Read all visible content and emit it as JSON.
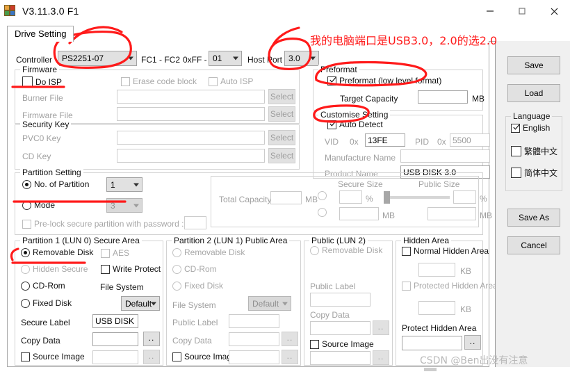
{
  "window": {
    "title": "V3.11.3.0 F1",
    "app_icon": "blocks-icon",
    "minimize": "minimize-icon",
    "maximize": "maximize-icon",
    "close": "close-icon"
  },
  "tabs": [
    {
      "label": "Drive Setting",
      "selected": true
    }
  ],
  "controller_row": {
    "label": "Controller",
    "value": "PS2251-07",
    "fc_label": "FC1 - FC2",
    "fc_prefix": "0xFF -",
    "fc_value": "01",
    "host_port_label": "Host Port",
    "host_port_value": "3.0"
  },
  "firmware": {
    "legend": "Firmware",
    "do_isp": {
      "label": "Do ISP",
      "checked": false
    },
    "erase_code_block": {
      "label": "Erase code block",
      "checked": false,
      "disabled": true
    },
    "auto_isp": {
      "label": "Auto ISP",
      "checked": false,
      "disabled": true
    },
    "burner_file": {
      "label": "Burner File",
      "value": "",
      "button": "Select"
    },
    "firmware_file": {
      "label": "Firmware File",
      "value": "",
      "button": "Select"
    }
  },
  "security_key": {
    "legend": "Security Key",
    "pvc0_key": {
      "label": "PVC0 Key",
      "value": "",
      "button": "Select"
    },
    "cd_key": {
      "label": "CD Key",
      "value": "",
      "button": "Select"
    }
  },
  "preformat": {
    "legend": "Preformat",
    "preformat": {
      "label": "Preformat (low level format)",
      "checked": true
    },
    "target_capacity": {
      "label": "Target Capacity",
      "value": "",
      "unit": "MB"
    }
  },
  "customise_setting": {
    "legend": "Customise Setting",
    "auto_detect": {
      "label": "Auto Detect",
      "checked": true
    },
    "vid": {
      "label": "VID",
      "prefix": "0x",
      "value": "13FE"
    },
    "pid": {
      "label": "PID",
      "prefix": "0x",
      "value": "5500"
    },
    "manufacture_name": {
      "label": "Manufacture Name",
      "value": ""
    },
    "product_name": {
      "label": "Product Name",
      "value": "USB DISK 3.0"
    }
  },
  "partition_setting": {
    "legend": "Partition Setting",
    "no_of_partition": {
      "label": "No. of Partition",
      "selected": true,
      "value": "1"
    },
    "mode": {
      "label": "Mode",
      "selected": false,
      "value": "3",
      "disabled": true
    },
    "prelock": {
      "label": "Pre-lock secure partition with password :",
      "checked": false,
      "disabled": true,
      "value": ""
    },
    "total_capacity": {
      "label": "Total Capacity",
      "value": "",
      "unit": "MB"
    },
    "secure_size_label": "Secure Size",
    "public_size_label": "Public Size",
    "secure_percent": "",
    "public_percent": "",
    "secure_mb": "",
    "public_mb": "",
    "percent_unit": "%",
    "mb_unit": "MB"
  },
  "partition1": {
    "legend": "Partition 1 (LUN 0) Secure Area",
    "removable_disk": {
      "label": "Removable Disk",
      "selected": true
    },
    "hidden_secure": {
      "label": "Hidden Secure",
      "selected": false,
      "disabled": true
    },
    "cd_rom": {
      "label": "CD-Rom",
      "selected": false
    },
    "fixed_disk": {
      "label": "Fixed Disk",
      "selected": false
    },
    "aes": {
      "label": "AES",
      "checked": false,
      "disabled": true
    },
    "write_protect": {
      "label": "Write Protect",
      "checked": false
    },
    "file_system": {
      "label": "File System",
      "value": "Default"
    },
    "secure_label": {
      "label": "Secure Label",
      "value": "USB DISK"
    },
    "copy_data": {
      "label": "Copy Data",
      "value": "",
      "button": ".."
    },
    "source_image": {
      "label": "Source Image",
      "checked": false,
      "value": "",
      "button": "..",
      "disabled": true
    }
  },
  "partition2": {
    "legend": "Partition 2 (LUN 1) Public Area",
    "removable_disk": {
      "label": "Removable Disk",
      "selected": false,
      "disabled": true
    },
    "cd_rom": {
      "label": "CD-Rom",
      "selected": false,
      "disabled": true
    },
    "fixed_disk": {
      "label": "Fixed Disk",
      "selected": false,
      "disabled": true
    },
    "file_system": {
      "label": "File System",
      "value": "Default",
      "disabled": true
    },
    "public_label": {
      "label": "Public Label",
      "value": "",
      "disabled": true
    },
    "copy_data": {
      "label": "Copy Data",
      "value": "",
      "button": "..",
      "disabled": true
    },
    "source_image": {
      "label": "Source Image",
      "checked": false,
      "value": "",
      "button": "..",
      "disabled": true
    }
  },
  "public_lun2": {
    "legend": "Public (LUN 2)",
    "removable_disk": {
      "label": "Removable Disk",
      "selected": false,
      "disabled": true
    },
    "public_label": {
      "label": "Public Label",
      "value": "",
      "disabled": true
    },
    "copy_data": {
      "label": "Copy Data",
      "value": "",
      "button": "..",
      "disabled": true
    },
    "source_image": {
      "label": "Source Image",
      "checked": false,
      "value": "",
      "button": "..",
      "disabled": true
    }
  },
  "hidden_area": {
    "legend": "Hidden Area",
    "normal_hidden_area": {
      "label": "Normal Hidden Area",
      "checked": false
    },
    "normal_size": {
      "value": "",
      "unit": "KB"
    },
    "protected_hidden_area": {
      "label": "Protected Hidden Area",
      "checked": false,
      "disabled": true
    },
    "protected_size": {
      "value": "",
      "unit": "KB"
    },
    "protect_hidden_area": {
      "label": "Protect Hidden Area",
      "value": "",
      "button": ".."
    }
  },
  "sidebar": {
    "save": "Save",
    "load": "Load",
    "language": {
      "legend": "Language",
      "options": [
        {
          "label": "English",
          "checked": true
        },
        {
          "label": "繁體中文",
          "checked": false
        },
        {
          "label": "简体中文",
          "checked": false
        }
      ]
    },
    "save_as": "Save As",
    "cancel": "Cancel"
  },
  "annotations": {
    "note_text": "我的电脑端口是USB3.0，2.0的选2.0",
    "color": "#ff1a1a"
  },
  "watermark": "CSDN @Ben出没有注意"
}
